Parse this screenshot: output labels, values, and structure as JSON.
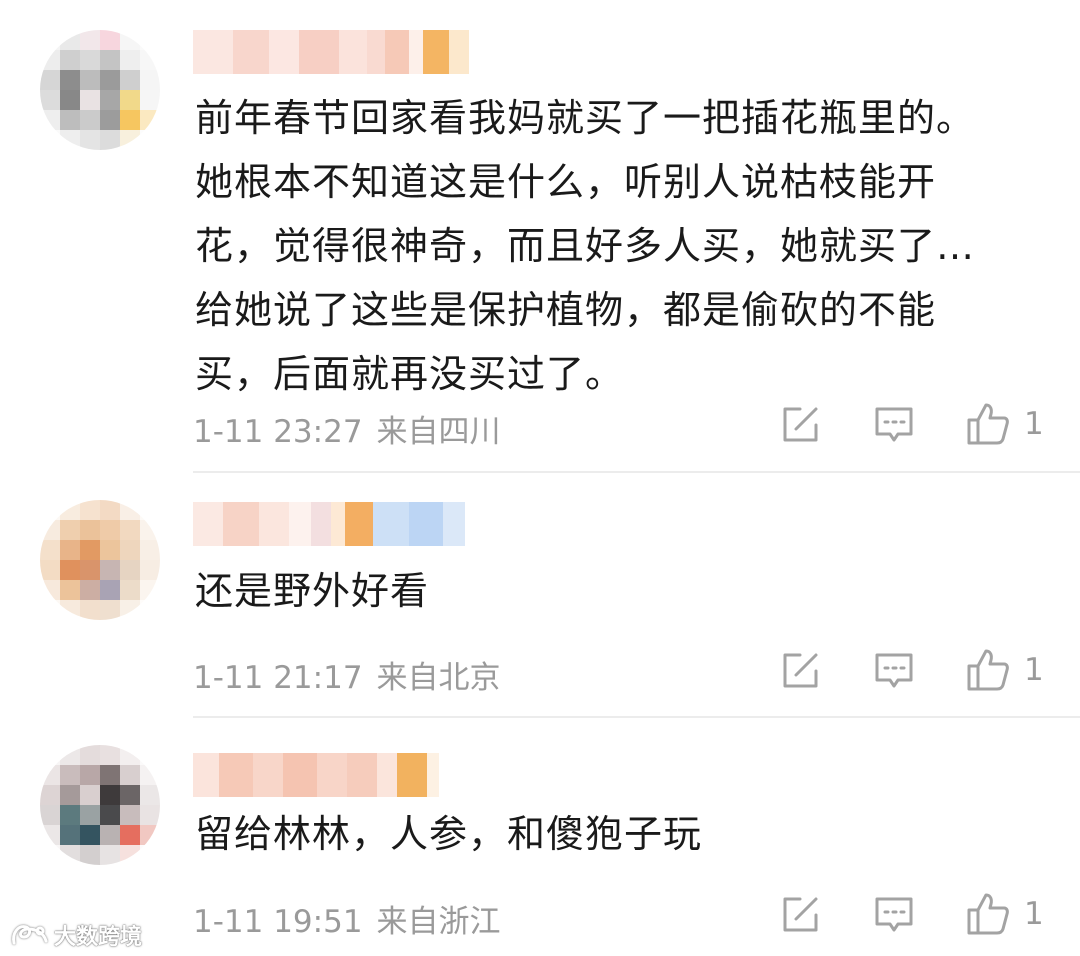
{
  "comments": [
    {
      "lines": [
        "前年春节回家看我妈就买了一把插花瓶里的。",
        "她根本不知道这是什么，听别人说枯枝能开",
        "花，觉得很神奇，而且好多人买，她就买了…",
        "给她说了这些是保护植物，都是偷砍的不能",
        "买，后面就再没买过了。"
      ],
      "time": "1-11 23:27",
      "location": "来自四川",
      "likes": "1"
    },
    {
      "lines": [
        "还是野外好看"
      ],
      "time": "1-11 21:17",
      "location": "来自北京",
      "likes": "1"
    },
    {
      "lines": [
        "留给林林，人参，和傻狍子玩"
      ],
      "time": "1-11 19:51",
      "location": "来自浙江",
      "likes": "1"
    }
  ],
  "icons": {
    "share": "share-edit-icon",
    "reply": "comment-bubble-icon",
    "like": "thumbs-up-icon"
  },
  "colors": {
    "meta_text": "#9a9a9a",
    "divider": "#ececec"
  },
  "watermark": {
    "text": "大数跨境"
  }
}
